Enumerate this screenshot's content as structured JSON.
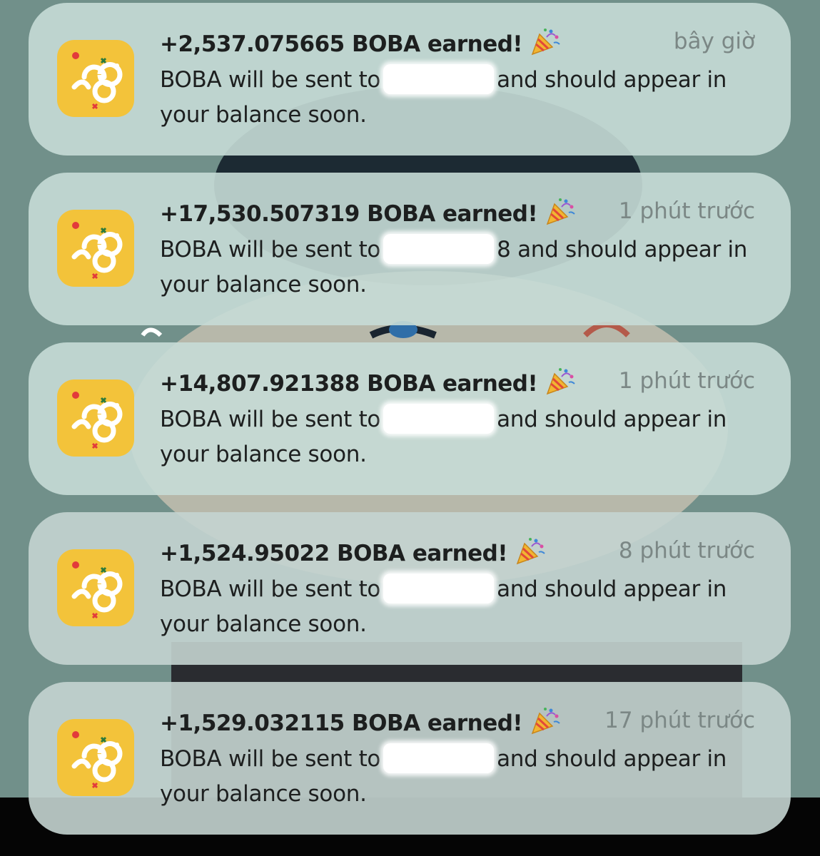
{
  "notifications": [
    {
      "title": "+2,537.075665 BOBA earned!",
      "time": "bây giờ",
      "body_prefix": "BOBA will be sent to",
      "body_suffix": "and should appear in",
      "body_line2": "your balance soon."
    },
    {
      "title": "+17,530.507319 BOBA earned!",
      "time": "1 phút trước",
      "body_prefix": "BOBA will be sent to",
      "body_suffix": "8 and should appear in",
      "body_line2": "your balance soon."
    },
    {
      "title": "+14,807.921388 BOBA earned!",
      "time": "1 phút trước",
      "body_prefix": "BOBA will be sent to",
      "body_suffix": "and should appear in",
      "body_line2": "your balance soon."
    },
    {
      "title": "+1,524.95022 BOBA earned!",
      "time": "8 phút trước",
      "body_prefix": "BOBA will be sent to",
      "body_suffix": "and should appear in",
      "body_line2": "your balance soon."
    },
    {
      "title": "+1,529.032115 BOBA earned!",
      "time": "17 phút trước",
      "body_prefix": "BOBA will be sent to",
      "body_suffix": "and should appear in",
      "body_line2": "your balance soon."
    }
  ],
  "colors": {
    "app_icon": "#f3c33a",
    "card": "#c6dcd6",
    "wallpaper": "#6f8d88"
  },
  "icons": {
    "app": "boba-app-icon",
    "emoji": "party-popper-icon"
  }
}
